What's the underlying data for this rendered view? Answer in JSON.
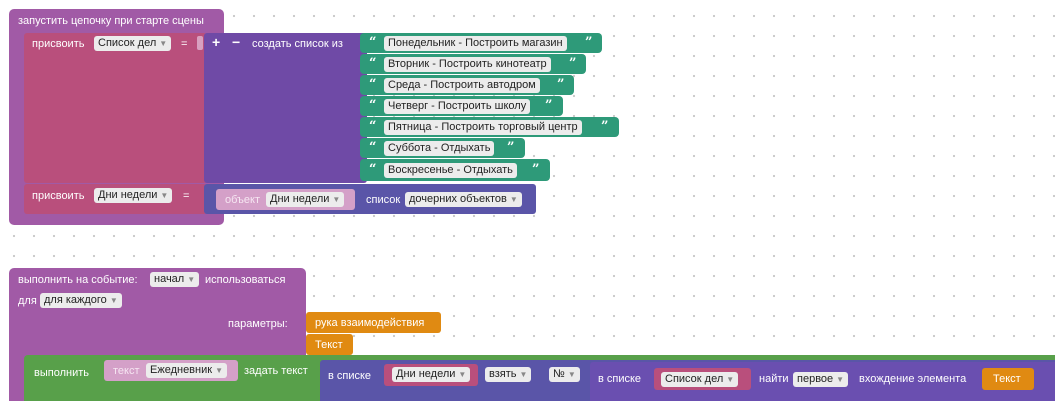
{
  "scene_block": {
    "title": "запустить цепочку при старте сцены",
    "assign1": {
      "label": "присвоить",
      "var": "Список дел",
      "eq": "=",
      "plus": "+",
      "minus": "−",
      "create_list": "создать список из",
      "items": [
        "Понедельник - Построить магазин",
        "Вторник - Построить кинотеатр",
        "Среда - Построить автодром",
        "Четверг - Построить школу",
        "Пятница - Построить торговый центр",
        "Суббота - Отдыхать",
        "Воскресенье - Отдыхать"
      ]
    },
    "assign2": {
      "label": "присвоить",
      "var": "Дни недели",
      "eq": "=",
      "object_label": "объект",
      "object_value": "Дни недели",
      "list_label": "список",
      "list_option": "дочерних объектов"
    }
  },
  "event_block": {
    "label": "выполнить на событие:",
    "event": "начал",
    "use_label": "использоваться",
    "for_label": "для",
    "for_option": "для каждого",
    "params_label": "параметры:",
    "param1": "рука взаимодействия",
    "param2": "Текст",
    "exec": {
      "label": "выполнить",
      "text_label": "текст",
      "text_value": "Ежедневник",
      "set_text": "задать текст",
      "in_list": "в списке",
      "list_var": "Дни недели",
      "take": "взять",
      "num": "№",
      "in_list2": "в списке",
      "list_var2": "Список дел",
      "find": "найти",
      "first": "первое",
      "occurrence": "вхождение элемента",
      "element": "Текст"
    }
  },
  "colors": {
    "event_purple": "#a15aa6",
    "list_violet": "#6f4aa6",
    "string_teal": "#2e9a79",
    "object_pink": "#b94f7c",
    "action_green": "#58a04a",
    "param_orange": "#e08a12"
  }
}
